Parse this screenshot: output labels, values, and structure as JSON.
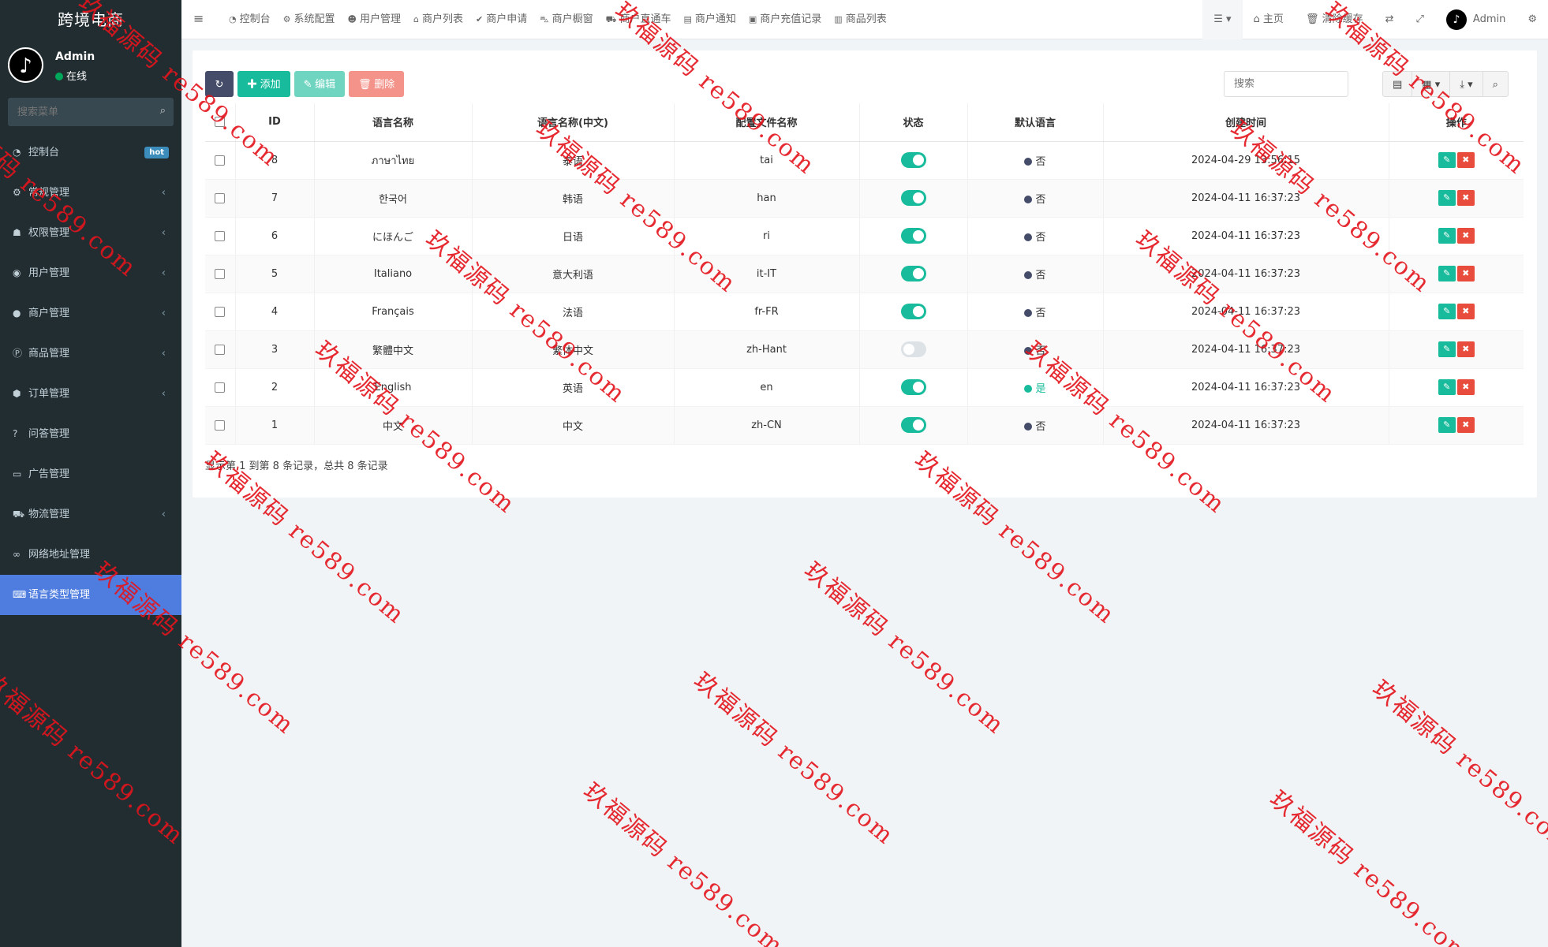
{
  "sidebar": {
    "brand": "跨境电商",
    "user": {
      "avatar_icon": "tiktok-icon",
      "name": "Admin",
      "status": "在线"
    },
    "search_placeholder": "搜索菜单",
    "menu": [
      {
        "label": "控制台",
        "icon": "dashboard-icon",
        "badge": "hot"
      },
      {
        "label": "常规管理",
        "icon": "cogs-icon",
        "chevron": "‹"
      },
      {
        "label": "权限管理",
        "icon": "group-icon",
        "chevron": "‹"
      },
      {
        "label": "用户管理",
        "icon": "user-circle-icon",
        "chevron": "‹"
      },
      {
        "label": "商户管理",
        "icon": "apple-icon",
        "chevron": "‹"
      },
      {
        "label": "商品管理",
        "icon": "product-hunt-icon",
        "chevron": "‹"
      },
      {
        "label": "订单管理",
        "icon": "cube-icon",
        "chevron": "‹"
      },
      {
        "label": "问答管理",
        "icon": "question-icon"
      },
      {
        "label": "广告管理",
        "icon": "credit-card-icon"
      },
      {
        "label": "物流管理",
        "icon": "truck-icon",
        "chevron": "‹"
      },
      {
        "label": "网络地址管理",
        "icon": "link-icon"
      },
      {
        "label": "语言类型管理",
        "icon": "language-icon",
        "active": true
      }
    ]
  },
  "topnav": {
    "tabs": [
      "控制台",
      "系统配置",
      "用户管理",
      "商户列表",
      "商户申请",
      "商户橱窗",
      "商户直通车",
      "商户通知",
      "商户充值记录",
      "商品列表"
    ],
    "right": {
      "home": "主页",
      "clear_cache": "清除缓存",
      "admin": "Admin"
    }
  },
  "toolbar": {
    "add": "添加",
    "edit": "编辑",
    "delete": "删除",
    "search_placeholder": "搜索"
  },
  "table": {
    "headers": [
      "ID",
      "语言名称",
      "语言名称(中文)",
      "配置文件名称",
      "状态",
      "默认语言",
      "创建时间",
      "操作"
    ],
    "rows": [
      {
        "id": "8",
        "name": "ภาษาไทย",
        "name_cn": "泰语",
        "file": "tai",
        "status": "on",
        "default": "否",
        "created": "2024-04-29 13:56:15"
      },
      {
        "id": "7",
        "name": "한국어",
        "name_cn": "韩语",
        "file": "han",
        "status": "on",
        "default": "否",
        "created": "2024-04-11 16:37:23"
      },
      {
        "id": "6",
        "name": "にほんご",
        "name_cn": "日语",
        "file": "ri",
        "status": "on",
        "default": "否",
        "created": "2024-04-11 16:37:23"
      },
      {
        "id": "5",
        "name": "Italiano",
        "name_cn": "意大利语",
        "file": "it-IT",
        "status": "on",
        "default": "否",
        "created": "2024-04-11 16:37:23"
      },
      {
        "id": "4",
        "name": "Français",
        "name_cn": "法语",
        "file": "fr-FR",
        "status": "on",
        "default": "否",
        "created": "2024-04-11 16:37:23"
      },
      {
        "id": "3",
        "name": "繁體中文",
        "name_cn": "繁体中文",
        "file": "zh-Hant",
        "status": "off",
        "default": "否",
        "created": "2024-04-11 16:37:23"
      },
      {
        "id": "2",
        "name": "English",
        "name_cn": "英语",
        "file": "en",
        "status": "on",
        "default": "是",
        "created": "2024-04-11 16:37:23"
      },
      {
        "id": "1",
        "name": "中文",
        "name_cn": "中文",
        "file": "zh-CN",
        "status": "on",
        "default": "否",
        "created": "2024-04-11 16:37:23"
      }
    ]
  },
  "footer": "显示第 1 到第 8 条记录，总共 8 条记录",
  "watermark": "玖福源码 re589.com",
  "colors": {
    "accent": "#18bc9c",
    "sidebar": "#222d32",
    "active_menu": "#4e7ddf",
    "danger": "#e74c3c"
  }
}
